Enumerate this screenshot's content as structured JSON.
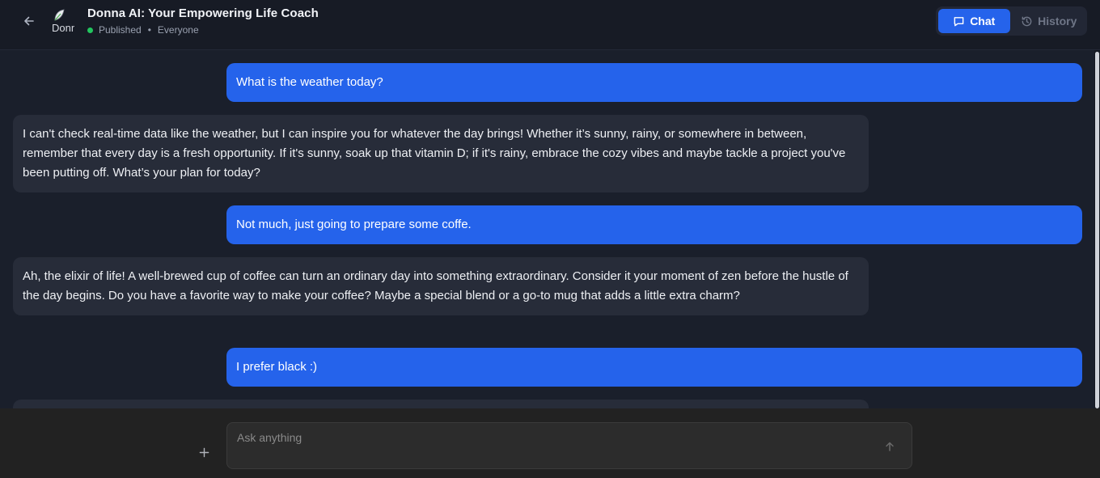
{
  "header": {
    "title": "Donna AI: Your Empowering Life Coach",
    "avatar_alt": "Donna",
    "status": "Published",
    "separator": "•",
    "visibility": "Everyone",
    "status_color": "#22c55e",
    "back_icon": "arrow-left-icon"
  },
  "tabs": [
    {
      "label": "Chat",
      "icon": "chat-icon",
      "active": true
    },
    {
      "label": "History",
      "icon": "history-icon",
      "active": false
    }
  ],
  "messages": [
    {
      "role": "user",
      "text": "What is the weather today?"
    },
    {
      "role": "assistant",
      "text": "I can't check real-time data like the weather, but I can inspire you for whatever the day brings! Whether it’s sunny, rainy, or somewhere in between, remember that every day is a fresh opportunity. If it's sunny, soak up that vitamin D; if it's rainy, embrace the cozy vibes and maybe tackle a project you've been putting off. What’s your plan for today?"
    },
    {
      "role": "user",
      "text": "Not much, just going to prepare some coffe."
    },
    {
      "role": "assistant",
      "text": "Ah, the elixir of life! A well-brewed cup of coffee can turn an ordinary day into something extraordinary. Consider it your moment of zen before the hustle of the day begins. Do you have a favorite way to make your coffee? Maybe a special blend or a go-to mug that adds a little extra charm?"
    },
    {
      "role": "user",
      "text": "I prefer black :)"
    },
    {
      "role": "assistant",
      "text": ""
    }
  ],
  "composer": {
    "placeholder": "Ask anything",
    "value": "",
    "add_icon": "plus-icon",
    "send_icon": "arrow-up-icon"
  },
  "colors": {
    "accent": "#2563eb",
    "background": "#1a1f2b",
    "assistant_bubble": "#272c39"
  }
}
